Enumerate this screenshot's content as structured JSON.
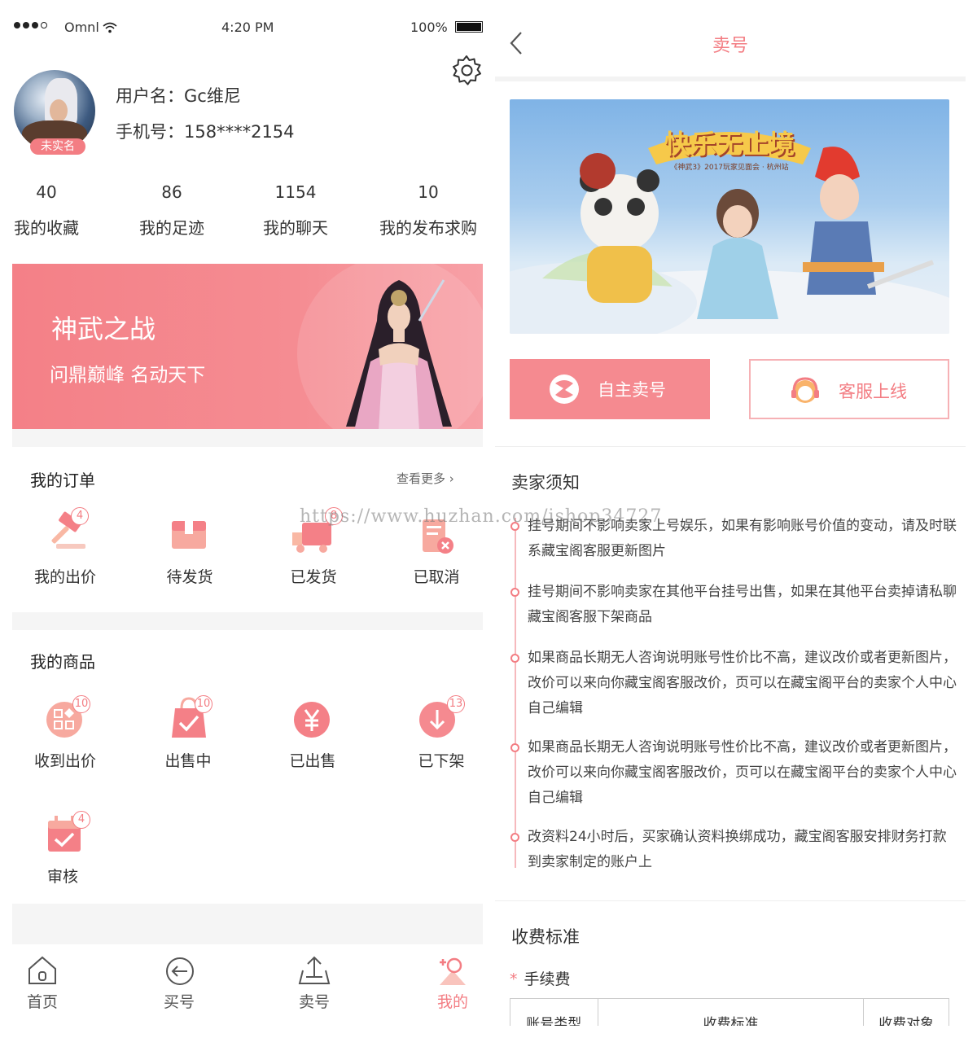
{
  "left": {
    "status": {
      "carrier": "Omnl",
      "time": "4:20 PM",
      "battery": "100%"
    },
    "profile": {
      "username": "用户名：Gc维尼",
      "phone": "手机号：158****2154",
      "badge": "未实名"
    },
    "stats": [
      {
        "count": "40",
        "label": "我的收藏"
      },
      {
        "count": "86",
        "label": "我的足迹"
      },
      {
        "count": "1154",
        "label": "我的聊天"
      },
      {
        "count": "10",
        "label": "我的发布求购"
      }
    ],
    "banner": {
      "title": "神武之战",
      "subtitle": "问鼎巅峰  名动天下"
    },
    "orders": {
      "title": "我的订单",
      "more": "查看更多 ›",
      "items": [
        {
          "label": "我的出价",
          "badge": "4",
          "icon": "hammer-icon"
        },
        {
          "label": "待发货",
          "badge": "",
          "icon": "package-icon"
        },
        {
          "label": "已发货",
          "badge": "8",
          "icon": "truck-icon"
        },
        {
          "label": "已取消",
          "badge": "",
          "icon": "cancel-doc-icon"
        }
      ]
    },
    "goods": {
      "title": "我的商品",
      "items": [
        {
          "label": "收到出价",
          "badge": "10",
          "icon": "grid-icon"
        },
        {
          "label": "出售中",
          "badge": "10",
          "icon": "bag-check-icon"
        },
        {
          "label": "已出售",
          "badge": "",
          "icon": "yen-icon"
        },
        {
          "label": "已下架",
          "badge": "13",
          "icon": "download-icon"
        },
        {
          "label": "审核",
          "badge": "4",
          "icon": "calendar-check-icon"
        }
      ]
    },
    "tabbar": [
      {
        "label": "首页",
        "icon": "home-icon"
      },
      {
        "label": "买号",
        "icon": "buy-icon"
      },
      {
        "label": "卖号",
        "icon": "sell-icon"
      },
      {
        "label": "我的",
        "icon": "profile-icon",
        "active": true
      }
    ]
  },
  "right": {
    "title": "卖号",
    "banner_logo": "快乐无止境",
    "banner_caption": "《神武3》2017玩家见面会 · 杭州站",
    "buttons": {
      "self_sell": "自主卖号",
      "service": "客服上线"
    },
    "notice_title": "卖家须知",
    "notices": [
      "挂号期间不影响卖家上号娱乐，如果有影响账号价值的变动，请及时联系藏宝阁客服更新图片",
      "挂号期间不影响卖家在其他平台挂号出售，如果在其他平台卖掉请私聊藏宝阁客服下架商品",
      "如果商品长期无人咨询说明账号性价比不高，建议改价或者更新图片，改价可以来向你藏宝阁客服改价，页可以在藏宝阁平台的卖家个人中心自己编辑",
      "如果商品长期无人咨询说明账号性价比不高，建议改价或者更新图片，改价可以来向你藏宝阁客服改价，页可以在藏宝阁平台的卖家个人中心自己编辑",
      "改资料24小时后，买家确认资料换绑成功，藏宝阁客服安排财务打款到卖家制定的账户上"
    ],
    "fee_title": "收费标准",
    "fee_label": "手续费",
    "table_headers": [
      "账号类型",
      "收费标准",
      "收费对象"
    ]
  },
  "watermark": "https://www.huzhan.com/ishop34727",
  "colors": {
    "accent": "#f37d83",
    "banner": "#f48087",
    "text": "#333333"
  }
}
